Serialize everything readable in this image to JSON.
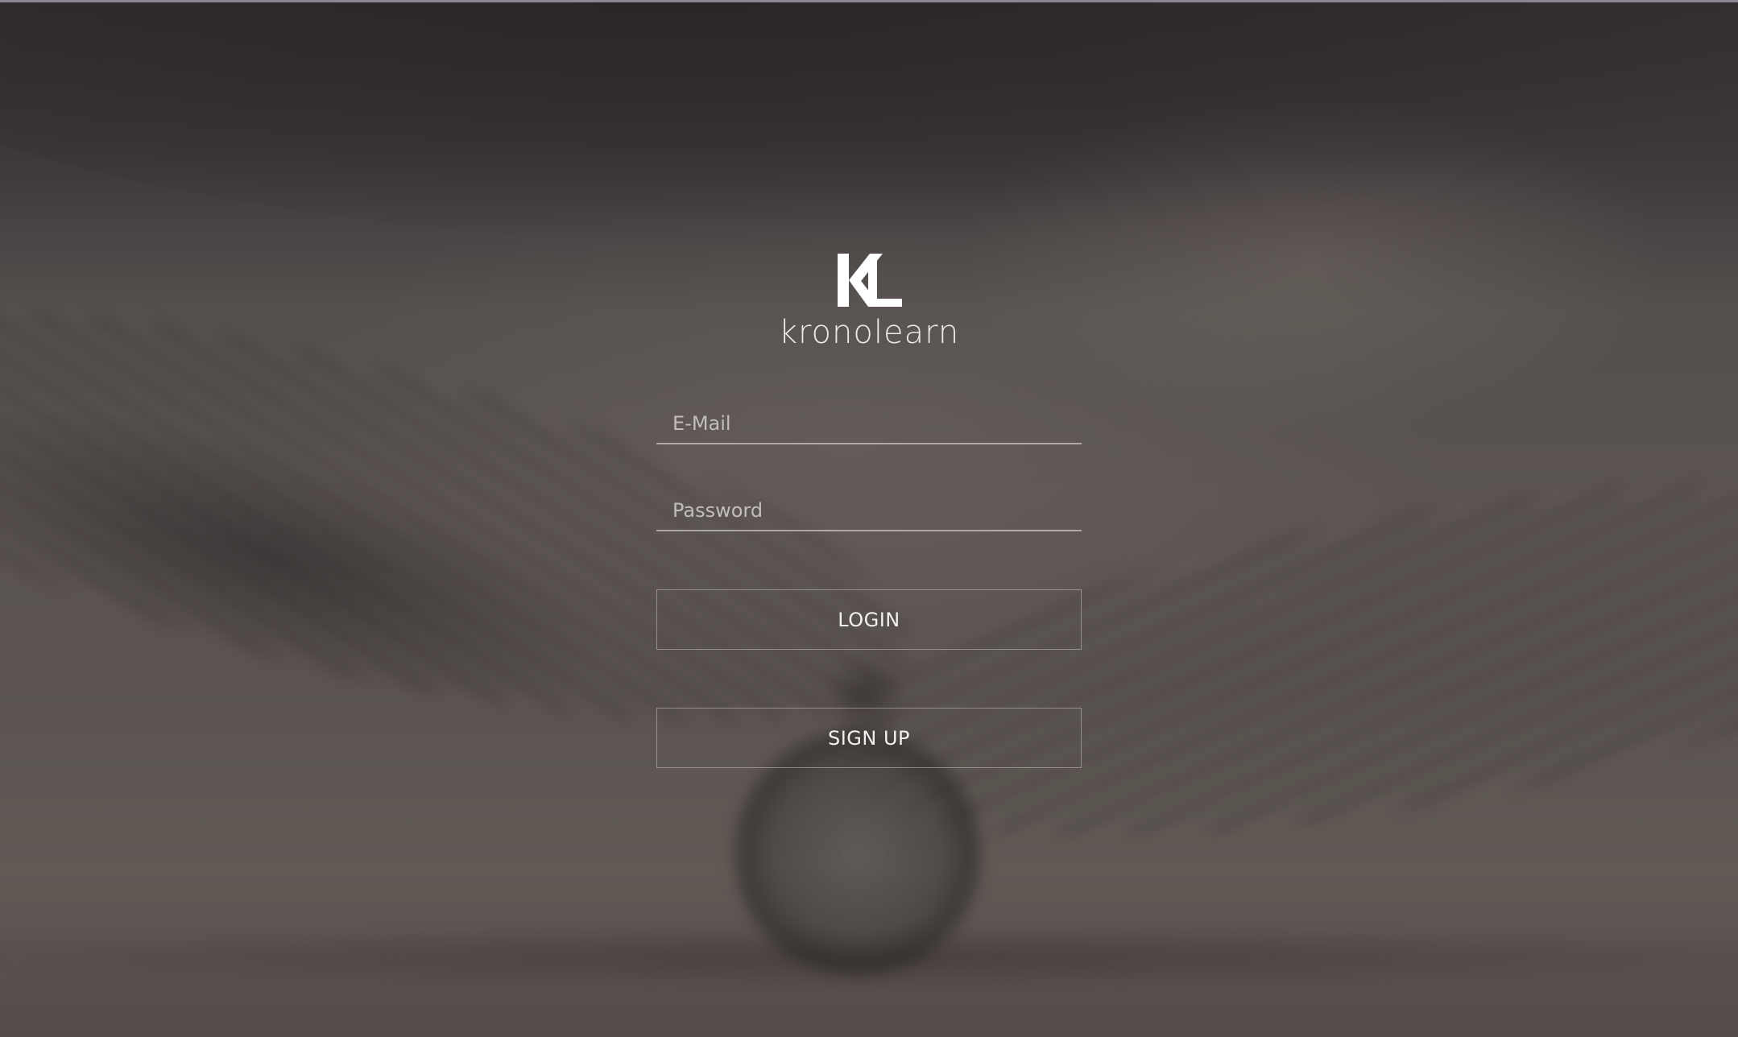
{
  "brand": {
    "logo_text": "KL",
    "name": "kronolearn"
  },
  "form": {
    "email_placeholder": "E-Mail",
    "password_placeholder": "Password",
    "login_label": "LOGIN",
    "signup_label": "SIGN UP"
  },
  "colors": {
    "text": "#ffffff",
    "field_underline": "#c8c4c4",
    "background": "#514947"
  }
}
